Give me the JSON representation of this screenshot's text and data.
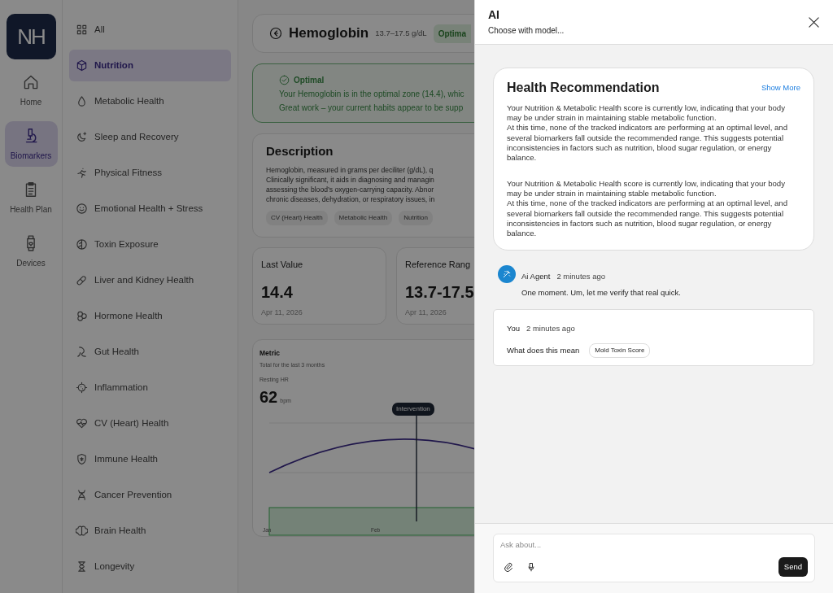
{
  "rail": {
    "logo": "NH",
    "items": [
      {
        "label": "Home",
        "selected": false
      },
      {
        "label": "Biomarkers",
        "selected": true
      },
      {
        "label": "Health Plan",
        "selected": false
      },
      {
        "label": "Devices",
        "selected": false
      }
    ]
  },
  "categories": [
    {
      "label": "All",
      "selected": false
    },
    {
      "label": "Nutrition",
      "selected": true
    },
    {
      "label": "Metabolic Health",
      "selected": false
    },
    {
      "label": "Sleep and Recovery",
      "selected": false
    },
    {
      "label": "Physical Fitness",
      "selected": false
    },
    {
      "label": "Emotional Health + Stress",
      "selected": false
    },
    {
      "label": "Toxin Exposure",
      "selected": false
    },
    {
      "label": "Liver and Kidney Health",
      "selected": false
    },
    {
      "label": "Hormone Health",
      "selected": false
    },
    {
      "label": "Gut Health",
      "selected": false
    },
    {
      "label": "Inflammation",
      "selected": false
    },
    {
      "label": "CV (Heart) Health",
      "selected": false
    },
    {
      "label": "Immune Health",
      "selected": false
    },
    {
      "label": "Cancer Prevention",
      "selected": false
    },
    {
      "label": "Brain Health",
      "selected": false
    },
    {
      "label": "Longevity",
      "selected": false
    }
  ],
  "biomarker": {
    "title": "Hemoglobin",
    "range": "13.7–17.5 g/dL",
    "status_badge": "Optima"
  },
  "status_card": {
    "title": "Optimal",
    "lines": [
      "Your Hemoglobin is in the optimal zone (14.4), whic",
      "Great work – your current habits appear to be supp"
    ]
  },
  "description": {
    "title": "Description",
    "lines": [
      "Hemoglobin, measured in grams per deciliter (g/dL), q",
      "Clinically significant, it aids in diagnosing and managin",
      "assessing the blood’s oxygen-carrying capacity. Abnor",
      "chronic diseases, dehydration, or respiratory issues, in"
    ],
    "tags": [
      "CV (Heart) Health",
      "Metabolic Health",
      "Nutrition"
    ]
  },
  "stats": [
    {
      "label": "Last Value",
      "value": "14.4",
      "date": "Apr 11, 2026"
    },
    {
      "label": "Reference Rang",
      "value": "13.7-17.5",
      "date": "Apr 11, 2026"
    }
  ],
  "metric": {
    "title": "Metric",
    "subtitle": "Total for the last 3 months",
    "reading_label": "Resting HR",
    "reading": "62",
    "unit": "bpm",
    "marker": "Intervention",
    "x_labels": [
      "Jan",
      "Feb"
    ]
  },
  "ai_panel": {
    "title": "AI",
    "subtitle": "Choose with model...",
    "recommendation": {
      "title": "Health Recommendation",
      "link": "Show More",
      "paragraphs": [
        [
          "Your Nutrition & Metabolic Health score is currently low, indicating that your body may be under strain in maintaining stable metabolic function.",
          "At this time, none of the tracked indicators are performing at an optimal level, and several biomarkers fall outside the recommended range. This suggests potential inconsistencies in factors such as nutrition, blood sugar regulation, or energy balance."
        ],
        [
          "Your Nutrition & Metabolic Health score is currently low, indicating that your body may be under strain in maintaining stable metabolic function.",
          "At this time, none of the tracked indicators are performing at an optimal level, and several biomarkers fall outside the recommended range. This suggests potential inconsistencies in factors such as nutrition, blood sugar regulation, or energy balance."
        ]
      ]
    },
    "messages": [
      {
        "kind": "agent",
        "author": "Ai Agent",
        "time": "2 minutes ago",
        "text": "One moment. Um, let me verify that real quick."
      },
      {
        "kind": "user",
        "author": "You",
        "time": "2 minutes ago",
        "text": "What does this mean",
        "chip": "Mold Toxin Score"
      }
    ],
    "composer": {
      "placeholder": "Ask about...",
      "send": "Send"
    }
  }
}
